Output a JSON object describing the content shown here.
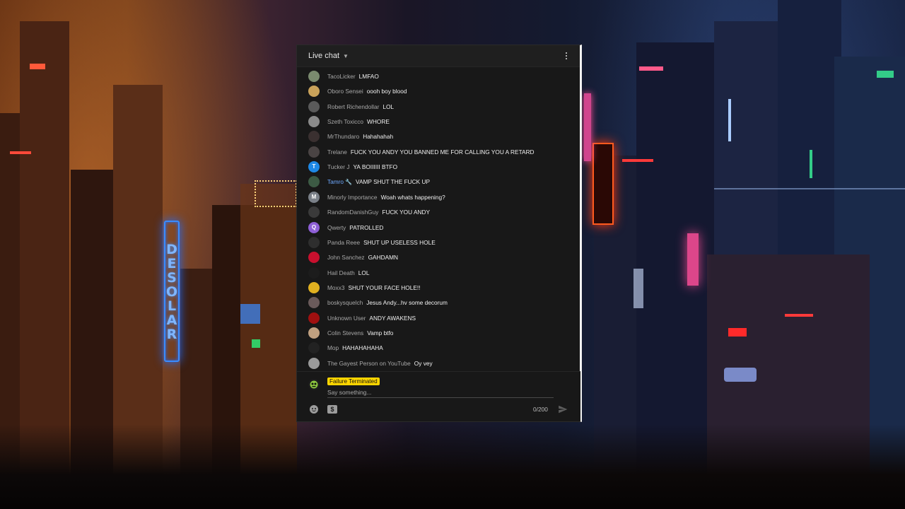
{
  "background": {
    "sign_text": "DESOLAR",
    "accent_orange": "#c8662a",
    "accent_blue": "#2a5fff",
    "neon_pink": "#ff4f9a"
  },
  "chat": {
    "title": "Live chat",
    "caret_icon": "chevron-down-icon",
    "menu_icon": "more-vert-icon",
    "messages": [
      {
        "author": "TacoLicker",
        "text": "LMFAO",
        "avatar_color": "#7a8a6e",
        "avatar_char": ""
      },
      {
        "author": "Oboro Sensei",
        "text": "oooh boy blood",
        "avatar_color": "#c9a25a",
        "avatar_char": ""
      },
      {
        "author": "Robert Richendollar",
        "text": "LOL",
        "avatar_color": "#5a5a5a",
        "avatar_char": ""
      },
      {
        "author": "Szeth Toxicco",
        "text": "WHORE",
        "avatar_color": "#8a8a8a",
        "avatar_char": ""
      },
      {
        "author": "MrThundaro",
        "text": "Hahahahah",
        "avatar_color": "#3a3030",
        "avatar_char": ""
      },
      {
        "author": "Trelane",
        "text": "FUCK YOU ANDY YOU BANNED ME FOR CALLING YOU A RETARD",
        "avatar_color": "#4a4444",
        "avatar_char": ""
      },
      {
        "author": "Tucker J",
        "text": "YA BOIIIIII BTFO",
        "avatar_color": "#1e88e5",
        "avatar_char": "T"
      },
      {
        "author": "Tamro",
        "text": "VAMP SHUT THE FUCK UP",
        "avatar_color": "#3c5a44",
        "avatar_char": "",
        "moderator": true
      },
      {
        "author": "Minorly Importance",
        "text": "Woah whats happening?",
        "avatar_color": "#7a8088",
        "avatar_char": "M"
      },
      {
        "author": "RandomDanishGuy",
        "text": "FUCK YOU ANDY",
        "avatar_color": "#3a3a3a",
        "avatar_char": ""
      },
      {
        "author": "Qwerty",
        "text": "PATROLLED",
        "avatar_color": "#8e5fd6",
        "avatar_char": "Q"
      },
      {
        "author": "Panda Reee",
        "text": "SHUT UP USELESS HOLE",
        "avatar_color": "#2e2e2e",
        "avatar_char": ""
      },
      {
        "author": "John Sanchez",
        "text": "GAHDAMN",
        "avatar_color": "#c8102e",
        "avatar_char": ""
      },
      {
        "author": "Hail Death",
        "text": "LOL",
        "avatar_color": "#1c1c1c",
        "avatar_char": ""
      },
      {
        "author": "Moxx3",
        "text": "SHUT YOUR FACE HOLE!!",
        "avatar_color": "#e0b020",
        "avatar_char": ""
      },
      {
        "author": "boskysquelch",
        "text": "Jesus Andy...hv some decorum",
        "avatar_color": "#6a5a5a",
        "avatar_char": ""
      },
      {
        "author": "Unknown User",
        "text": "ANDY AWAKENS",
        "avatar_color": "#a01010",
        "avatar_char": ""
      },
      {
        "author": "Colin Stevens",
        "text": "Vamp btfo",
        "avatar_color": "#c0a080",
        "avatar_char": ""
      },
      {
        "author": "Mop",
        "text": "HAHAHAHAHA",
        "avatar_color": "#222222",
        "avatar_char": ""
      },
      {
        "author": "The Gayest Person on YouTube",
        "text": "Oy vey",
        "avatar_color": "#9a9a9a",
        "avatar_char": ""
      }
    ]
  },
  "composer": {
    "current_user": "Failure Terminated",
    "current_user_badge_color": "#ffd600",
    "placeholder": "Say something...",
    "value": "",
    "counter": "0/200",
    "emoji_icon": "emoji-icon",
    "superchat_icon": "super-chat-icon",
    "send_icon": "send-icon"
  }
}
